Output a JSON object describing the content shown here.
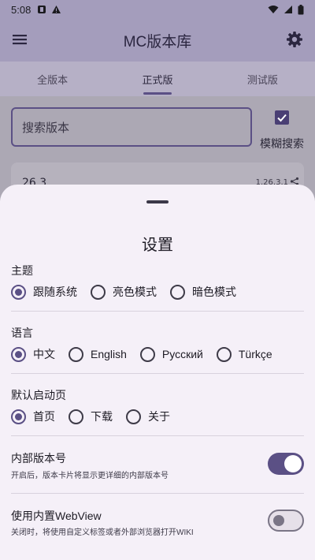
{
  "status_bar": {
    "time": "5:08",
    "icons_left": [
      "notification-icon",
      "alert-icon"
    ],
    "icons_right": [
      "wifi-icon",
      "signal-icon",
      "battery-icon"
    ]
  },
  "app_bar": {
    "title": "MC版本库",
    "menu_icon": "menu-icon",
    "settings_icon": "gear-icon"
  },
  "tabs": [
    {
      "label": "全版本",
      "active": false
    },
    {
      "label": "正式版",
      "active": true
    },
    {
      "label": "测试版",
      "active": false
    }
  ],
  "search": {
    "placeholder": "搜索版本",
    "fuzzy_label": "模糊搜索",
    "fuzzy_checked": true
  },
  "version_card": {
    "name": "26.3",
    "code": "1.26.3.1"
  },
  "settings": {
    "title": "设置",
    "theme": {
      "label": "主题",
      "options": [
        "跟随系统",
        "亮色模式",
        "暗色模式"
      ],
      "selected": 0
    },
    "language": {
      "label": "语言",
      "options": [
        "中文",
        "English",
        "Русский",
        "Türkçe"
      ],
      "selected": 0
    },
    "start_page": {
      "label": "默认启动页",
      "options": [
        "首页",
        "下载",
        "关于"
      ],
      "selected": 0
    },
    "internal_version": {
      "label": "内部版本号",
      "description": "开启后，版本卡片将显示更详细的内部版本号",
      "enabled": true
    },
    "webview": {
      "label": "使用内置WebView",
      "description": "关闭时，将使用自定义标签或者外部浏览器打开WIKI",
      "enabled": false
    }
  },
  "colors": {
    "accent": "#5b5085",
    "sheet_bg": "#f5f0f8",
    "scrim": "#aca8b4"
  }
}
